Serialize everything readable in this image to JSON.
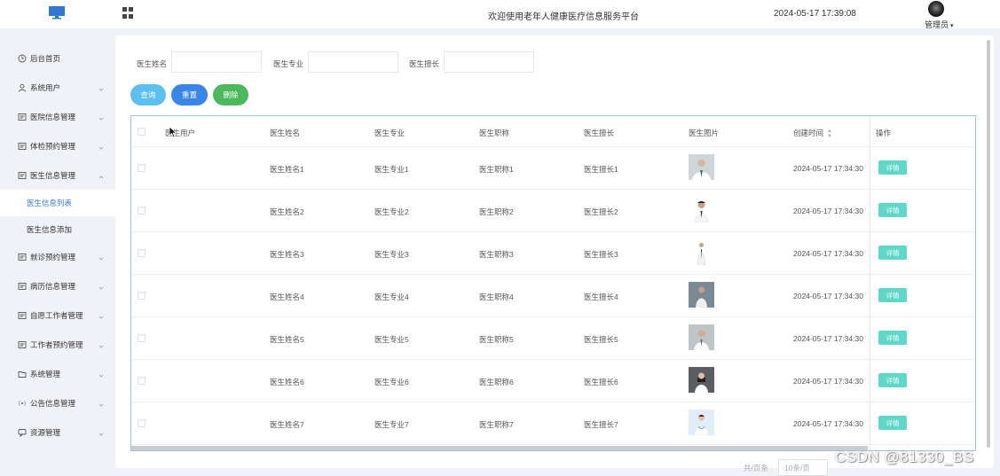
{
  "header": {
    "site_title": "欢迎使用老年人健康医疗信息服务平台",
    "datetime": "2024-05-17 17:39:08",
    "user": "管理员"
  },
  "sidebar": {
    "items": [
      {
        "label": "后台首页",
        "icon": "clock-icon",
        "has_caret": false
      },
      {
        "label": "系统用户",
        "icon": "user-icon",
        "has_caret": true
      },
      {
        "label": "医院信息管理",
        "icon": "list-icon",
        "has_caret": true
      },
      {
        "label": "体检预约管理",
        "icon": "list-icon",
        "has_caret": true
      },
      {
        "label": "医生信息管理",
        "icon": "list-icon",
        "has_caret": true,
        "expanded": true
      },
      {
        "label": "就诊预约管理",
        "icon": "list-icon",
        "has_caret": true
      },
      {
        "label": "病历信息管理",
        "icon": "list-icon",
        "has_caret": true
      },
      {
        "label": "自愿工作者管理",
        "icon": "list-icon",
        "has_caret": true
      },
      {
        "label": "工作者预约管理",
        "icon": "list-icon",
        "has_caret": true
      },
      {
        "label": "系统管理",
        "icon": "folder-icon",
        "has_caret": true
      },
      {
        "label": "公告信息管理",
        "icon": "broadcast-icon",
        "has_caret": true
      },
      {
        "label": "资源管理",
        "icon": "chat-icon",
        "has_caret": true
      }
    ],
    "sub_items": [
      {
        "label": "医生信息列表",
        "active": true
      },
      {
        "label": "医生信息添加",
        "active": false
      }
    ]
  },
  "filters": {
    "name_label": "医生姓名",
    "name_value": "",
    "specialty_label": "医生专业",
    "specialty_value": "",
    "expertise_label": "医生擅长",
    "expertise_value": ""
  },
  "buttons": {
    "search": "查询",
    "reset": "重置",
    "delete": "删除"
  },
  "colors": {
    "search": "#5bc0f0",
    "reset": "#3a86e8",
    "delete": "#4cb85c",
    "detail": "#5fd8c9",
    "active_menu": "#3a7bd5"
  },
  "table": {
    "columns": [
      "医生用户",
      "医生姓名",
      "医生专业",
      "医生职称",
      "医生擅长",
      "医生图片",
      "创建时间",
      "操作"
    ],
    "rows": [
      {
        "user": "",
        "name": "医生姓名1",
        "specialty": "医生专业1",
        "title": "医生职称1",
        "expertise": "医生擅长1",
        "created": "2024-05-17 17:34:30",
        "action": "详情"
      },
      {
        "user": "",
        "name": "医生姓名2",
        "specialty": "医生专业2",
        "title": "医生职称2",
        "expertise": "医生擅长2",
        "created": "2024-05-17 17:34:30",
        "action": "详情"
      },
      {
        "user": "",
        "name": "医生姓名3",
        "specialty": "医生专业3",
        "title": "医生职称3",
        "expertise": "医生擅长3",
        "created": "2024-05-17 17:34:30",
        "action": "详情"
      },
      {
        "user": "",
        "name": "医生姓名4",
        "specialty": "医生专业4",
        "title": "医生职称4",
        "expertise": "医生擅长4",
        "created": "2024-05-17 17:34:30",
        "action": "详情"
      },
      {
        "user": "",
        "name": "医生姓名5",
        "specialty": "医生专业5",
        "title": "医生职称5",
        "expertise": "医生擅长5",
        "created": "2024-05-17 17:34:30",
        "action": "详情"
      },
      {
        "user": "",
        "name": "医生姓名6",
        "specialty": "医生专业6",
        "title": "医生职称6",
        "expertise": "医生擅长6",
        "created": "2024-05-17 17:34:30",
        "action": "详情"
      },
      {
        "user": "",
        "name": "医生姓名7",
        "specialty": "医生专业7",
        "title": "医生职称7",
        "expertise": "医生擅长7",
        "created": "2024-05-17 17:34:30",
        "action": "详情"
      }
    ]
  },
  "pager": {
    "label": "共/页条",
    "select": "10条/页"
  },
  "watermark": "CSDN @81330_BS"
}
